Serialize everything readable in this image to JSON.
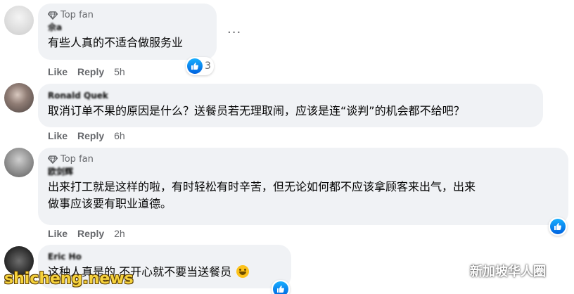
{
  "comments": [
    {
      "badge": "Top fan",
      "author": "佘a",
      "text": "有些人真的不适合做服务业",
      "like": "Like",
      "reply": "Reply",
      "time": "5h",
      "reactions": "3"
    },
    {
      "author": "Ronald Quek",
      "text": "取消订单不果的原因是什么？送餐员若无理取闹，应该是连“谈判”的机会都不给吧？",
      "like": "Like",
      "reply": "Reply",
      "time": "6h"
    },
    {
      "badge": "Top fan",
      "author": "欧剑辉",
      "text_line1": "出来打工就是这样的啦，有时轻松有时辛苦，但无论如何都不应该拿顾客来出气，出来",
      "text_line2": "做事应该要有职业道德。",
      "like": "Like",
      "reply": "Reply",
      "time": "2h"
    },
    {
      "author": "Eric Ho",
      "text": "这种人真是的 不开心就不要当送餐员",
      "emoji": "grinning-sweat-emoji"
    }
  ],
  "more_options": "···",
  "watermark_left": "shicheng.news",
  "watermark_right": "新加坡华人圈",
  "colors": {
    "bubble": "#f0f2f5",
    "meta": "#65676b",
    "like_blue": "#0571ed",
    "watermark_yellow": "#f6d23c"
  }
}
